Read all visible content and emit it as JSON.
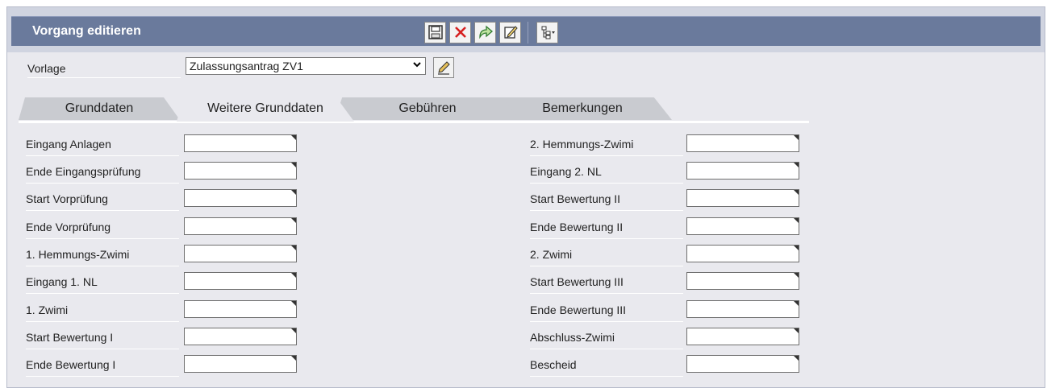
{
  "window": {
    "title": "Vorgang editieren"
  },
  "toolbar": {
    "icons": [
      "save-icon",
      "delete-icon",
      "forward-icon",
      "edit-note-icon",
      "hierarchy-menu-icon"
    ]
  },
  "vorlage": {
    "label": "Vorlage",
    "selected": "Zulassungsantrag ZV1"
  },
  "tabs": [
    {
      "label": "Grunddaten",
      "active": false
    },
    {
      "label": "Weitere Grunddaten",
      "active": true
    },
    {
      "label": "Gebühren",
      "active": false
    },
    {
      "label": "Bemerkungen",
      "active": false
    }
  ],
  "left_fields": [
    {
      "label": "Eingang Anlagen",
      "value": ""
    },
    {
      "label": "Ende Eingangsprüfung",
      "value": ""
    },
    {
      "label": "Start Vorprüfung",
      "value": ""
    },
    {
      "label": "Ende Vorprüfung",
      "value": ""
    },
    {
      "label": "1. Hemmungs-Zwimi",
      "value": ""
    },
    {
      "label": "Eingang 1. NL",
      "value": ""
    },
    {
      "label": "1. Zwimi",
      "value": ""
    },
    {
      "label": "Start Bewertung I",
      "value": ""
    },
    {
      "label": "Ende Bewertung I",
      "value": ""
    }
  ],
  "right_fields": [
    {
      "label": "2. Hemmungs-Zwimi",
      "value": ""
    },
    {
      "label": "Eingang 2. NL",
      "value": ""
    },
    {
      "label": "Start Bewertung II",
      "value": ""
    },
    {
      "label": "Ende Bewertung II",
      "value": ""
    },
    {
      "label": "2. Zwimi",
      "value": ""
    },
    {
      "label": "Start Bewertung III",
      "value": ""
    },
    {
      "label": "Ende Bewertung III",
      "value": ""
    },
    {
      "label": "Abschluss-Zwimi",
      "value": ""
    },
    {
      "label": "Bescheid",
      "value": ""
    }
  ]
}
